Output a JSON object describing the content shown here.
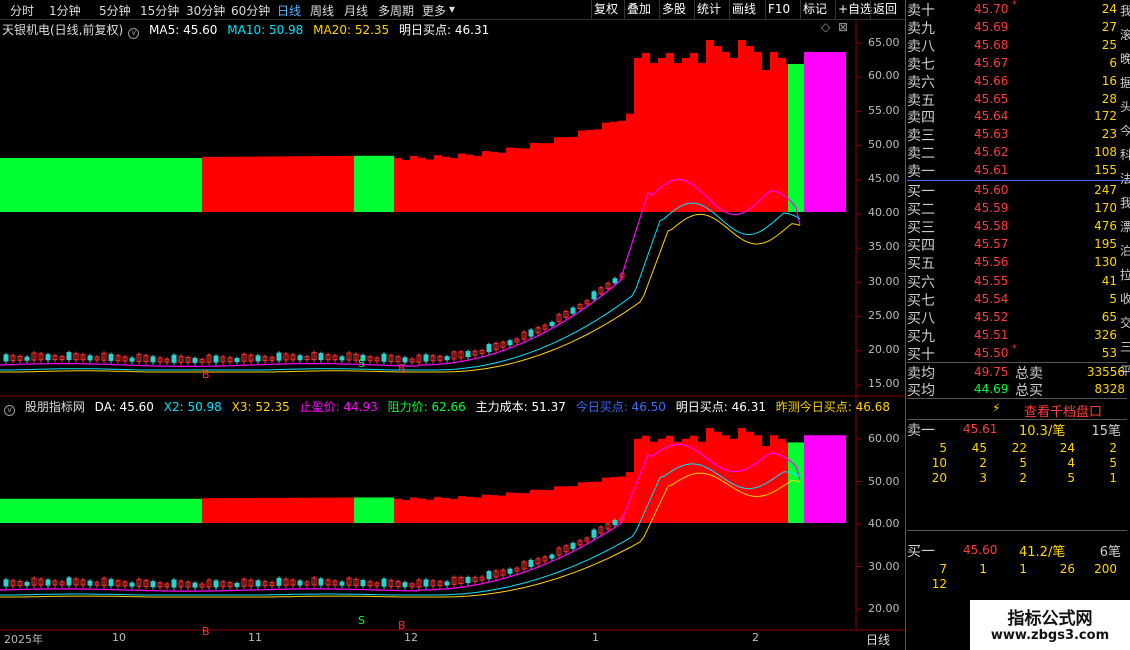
{
  "toolbar": {
    "periods": [
      "分时",
      "1分钟",
      "5分钟",
      "15分钟",
      "30分钟",
      "60分钟",
      "日线",
      "周线",
      "月线",
      "多周期",
      "更多"
    ],
    "active": "日线",
    "buttons": [
      "复权",
      "叠加",
      "多股",
      "统计",
      "画线",
      "F10",
      "标记",
      "+自选",
      "返回"
    ]
  },
  "main_chart": {
    "title": "天银机电(日线,前复权)",
    "ma5": "MA5: 45.60",
    "ma10": "MA10: 50.98",
    "ma20": "MA20: 52.35",
    "buy_point": "明日买点: 46.31",
    "y_ticks": [
      "65.00",
      "60.00",
      "55.00",
      "50.00",
      "45.00",
      "40.00",
      "35.00",
      "30.00",
      "25.00",
      "20.00",
      "15.00"
    ]
  },
  "indicator_chart": {
    "title": "股朋指标网",
    "da": "DA: 45.60",
    "x2": "X2: 50.98",
    "x3": "X3: 52.35",
    "stop": "止盈价: 44.93",
    "resist": "阻力价: 62.66",
    "cost": "主力成本: 51.37",
    "today_buy": "今日买点: 46.50",
    "tomorrow_buy": "明日买点: 46.31",
    "yesterday_pred": "昨测今日买点: 46.68",
    "y_ticks": [
      "60.00",
      "50.00",
      "40.00",
      "30.00",
      "20.00"
    ]
  },
  "x_axis": {
    "labels": [
      "2025年",
      "10",
      "11",
      "12",
      "1",
      "2"
    ],
    "period": "日线"
  },
  "order_book": {
    "asks": [
      {
        "label": "卖十",
        "price": "45.70",
        "vol": "24",
        "mark": "*"
      },
      {
        "label": "卖九",
        "price": "45.69",
        "vol": "27",
        "mark": ""
      },
      {
        "label": "卖八",
        "price": "45.68",
        "vol": "25",
        "mark": ""
      },
      {
        "label": "卖七",
        "price": "45.67",
        "vol": "6",
        "mark": ""
      },
      {
        "label": "卖六",
        "price": "45.66",
        "vol": "16",
        "mark": ""
      },
      {
        "label": "卖五",
        "price": "45.65",
        "vol": "28",
        "mark": ""
      },
      {
        "label": "卖四",
        "price": "45.64",
        "vol": "172",
        "mark": ""
      },
      {
        "label": "卖三",
        "price": "45.63",
        "vol": "23",
        "mark": ""
      },
      {
        "label": "卖二",
        "price": "45.62",
        "vol": "108",
        "mark": ""
      },
      {
        "label": "卖一",
        "price": "45.61",
        "vol": "155",
        "mark": ""
      }
    ],
    "bids": [
      {
        "label": "买一",
        "price": "45.60",
        "vol": "247",
        "mark": ""
      },
      {
        "label": "买二",
        "price": "45.59",
        "vol": "170",
        "mark": ""
      },
      {
        "label": "买三",
        "price": "45.58",
        "vol": "476",
        "mark": ""
      },
      {
        "label": "买四",
        "price": "45.57",
        "vol": "195",
        "mark": ""
      },
      {
        "label": "买五",
        "price": "45.56",
        "vol": "130",
        "mark": ""
      },
      {
        "label": "买六",
        "price": "45.55",
        "vol": "41",
        "mark": ""
      },
      {
        "label": "买七",
        "price": "45.54",
        "vol": "5",
        "mark": ""
      },
      {
        "label": "买八",
        "price": "45.52",
        "vol": "65",
        "mark": ""
      },
      {
        "label": "买九",
        "price": "45.51",
        "vol": "326",
        "mark": ""
      },
      {
        "label": "买十",
        "price": "45.50",
        "vol": "53",
        "mark": "*"
      }
    ],
    "ask_avg_label": "卖均",
    "ask_avg": "49.75",
    "total_ask_label": "总卖",
    "total_ask": "33556",
    "bid_avg_label": "买均",
    "bid_avg": "44.69",
    "total_bid_label": "总买",
    "total_bid": "8328",
    "thousand_btn": "查看千档盘口"
  },
  "queue": {
    "ask_label": "卖一",
    "ask_price": "45.61",
    "ask_amt": "10.3/笔",
    "ask_cnt": "15笔",
    "ask_rows": [
      [
        "5",
        "45",
        "22",
        "24",
        "2"
      ],
      [
        "10",
        "2",
        "5",
        "4",
        "5"
      ],
      [
        "20",
        "3",
        "2",
        "5",
        "1"
      ]
    ],
    "bid_label": "买一",
    "bid_price": "45.60",
    "bid_amt": "41.2/笔",
    "bid_cnt": "6笔",
    "bid_rows": [
      [
        "7",
        "1",
        "1",
        "26",
        "200"
      ],
      [
        "12",
        "",
        "",
        "",
        ""
      ]
    ]
  },
  "side_strip": [
    "我",
    "滚",
    "晚",
    "据",
    "头",
    "今",
    "科",
    "法",
    "我",
    "漂",
    "泊",
    "拉",
    "收",
    "交",
    "三",
    "平"
  ],
  "watermark": {
    "line1": "指标公式网",
    "line2": "www.zbgs3.com"
  },
  "colors": {
    "red": "#ff0000",
    "green": "#00ff33",
    "magenta": "#ff00ff",
    "yellow": "#ffd400",
    "cyan": "#00e5ff",
    "blue": "#3a6cff"
  }
}
